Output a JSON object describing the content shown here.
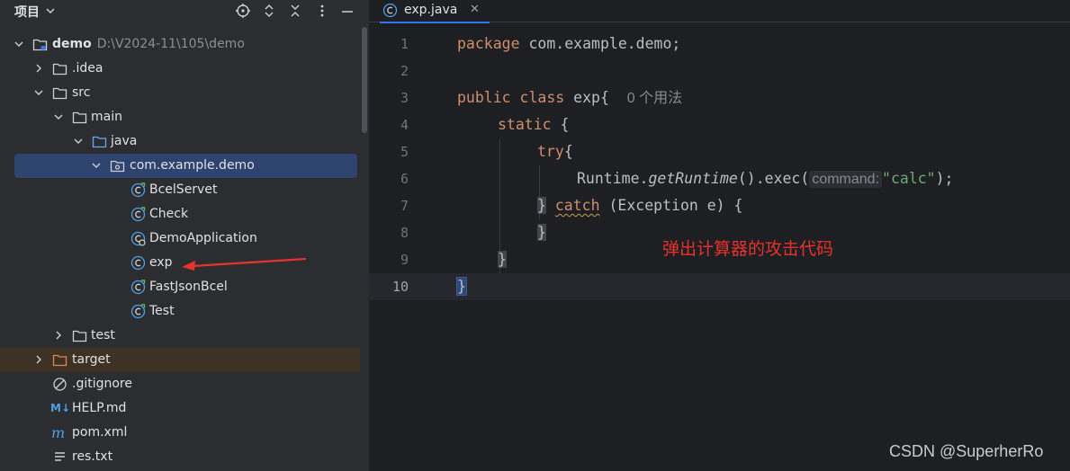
{
  "sidebar": {
    "title": "项目",
    "tree": [
      {
        "label": "demo",
        "path": "D:\\V2024-11\\105\\demo",
        "icon": "module-folder-icon",
        "expanded": true
      },
      {
        "label": ".idea",
        "icon": "folder-icon",
        "expanded": false
      },
      {
        "label": "src",
        "icon": "folder-icon",
        "expanded": true
      },
      {
        "label": "main",
        "icon": "folder-icon",
        "expanded": true
      },
      {
        "label": "java",
        "icon": "source-folder-icon",
        "expanded": true
      },
      {
        "label": "com.example.demo",
        "icon": "package-icon",
        "expanded": true,
        "selected": true
      },
      {
        "label": "BcelServet",
        "icon": "java-class-icon"
      },
      {
        "label": "Check",
        "icon": "java-class-icon"
      },
      {
        "label": "DemoApplication",
        "icon": "spring-boot-class-icon"
      },
      {
        "label": "exp",
        "icon": "java-class-icon"
      },
      {
        "label": "FastJsonBcel",
        "icon": "java-class-icon"
      },
      {
        "label": "Test",
        "icon": "java-class-icon"
      },
      {
        "label": "test",
        "icon": "folder-icon",
        "expanded": false
      },
      {
        "label": "target",
        "icon": "excluded-folder-icon",
        "expanded": false
      },
      {
        "label": ".gitignore",
        "icon": "ignore-file-icon"
      },
      {
        "label": "HELP.md",
        "icon": "markdown-file-icon"
      },
      {
        "label": "pom.xml",
        "icon": "maven-file-icon"
      },
      {
        "label": "res.txt",
        "icon": "text-file-icon"
      }
    ]
  },
  "editor": {
    "tab": {
      "label": "exp.java",
      "close": "✕"
    },
    "line_numbers": [
      "1",
      "2",
      "3",
      "4",
      "5",
      "6",
      "7",
      "8",
      "9",
      "10"
    ],
    "current_line": "10",
    "code": {
      "l1_kw": "package",
      "l1_rest": " com.example.demo;",
      "l3_kw1": "public",
      "l3_kw2": "class",
      "l3_name": "exp",
      "l3_brace": "{",
      "l3_hint": "0 个用法",
      "l4_kw": "static",
      "l4_brace": "{",
      "l5_kw": "try",
      "l5_brace": "{",
      "l6_pre": "Runtime.",
      "l6_method": "getRuntime",
      "l6_mid": "().exec(",
      "l6_hint": "command:",
      "l6_str": "\"calc\"",
      "l6_end": ");",
      "l7_brace": "}",
      "l7_kw": "catch",
      "l7_rest": " (Exception e) {",
      "l8_brace": "}",
      "l9_brace": "}",
      "l10_brace": "}"
    },
    "annotation": "弹出计算器的攻击代码"
  },
  "watermark": "CSDN @SuperherRo",
  "colors": {
    "accent": "#3574f0",
    "keyword": "#cf8e6d",
    "string": "#6aab73",
    "annotation_red": "#e8322c",
    "class_icon": "#4fa0e8"
  }
}
